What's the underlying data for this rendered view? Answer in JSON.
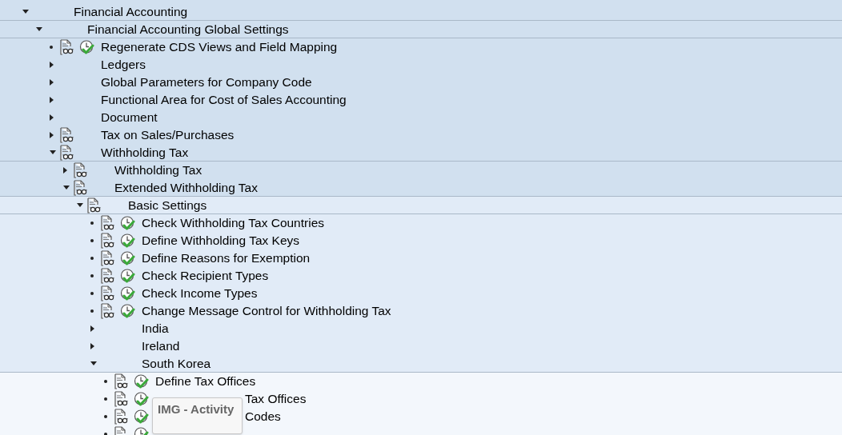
{
  "tree": [
    {
      "label": "Financial Accounting",
      "kind": "folder",
      "expanded": true,
      "has_docs": false,
      "children": [
        {
          "label": "Financial Accounting Global Settings",
          "kind": "folder",
          "expanded": true,
          "has_docs": false,
          "children": [
            {
              "label": "Regenerate CDS Views and Field Mapping",
              "kind": "activity"
            },
            {
              "label": "Ledgers",
              "kind": "folder",
              "expanded": false,
              "has_docs": false
            },
            {
              "label": "Global Parameters for Company Code",
              "kind": "folder",
              "expanded": false,
              "has_docs": false
            },
            {
              "label": "Functional Area for Cost of Sales Accounting",
              "kind": "folder",
              "expanded": false,
              "has_docs": false
            },
            {
              "label": "Document",
              "kind": "folder",
              "expanded": false,
              "has_docs": false
            },
            {
              "label": "Tax on Sales/Purchases",
              "kind": "folder",
              "expanded": false,
              "has_docs": true
            },
            {
              "label": "Withholding Tax",
              "kind": "folder",
              "expanded": true,
              "has_docs": true,
              "children": [
                {
                  "label": "Withholding Tax",
                  "kind": "folder",
                  "expanded": false,
                  "has_docs": true
                },
                {
                  "label": "Extended Withholding Tax",
                  "kind": "folder",
                  "expanded": true,
                  "has_docs": true,
                  "children": [
                    {
                      "label": "Basic Settings",
                      "kind": "folder",
                      "expanded": true,
                      "has_docs": true,
                      "children": [
                        {
                          "label": "Check Withholding Tax Countries",
                          "kind": "activity"
                        },
                        {
                          "label": "Define Withholding Tax Keys",
                          "kind": "activity"
                        },
                        {
                          "label": "Define Reasons for Exemption",
                          "kind": "activity"
                        },
                        {
                          "label": "Check Recipient Types",
                          "kind": "activity"
                        },
                        {
                          "label": "Check Income Types",
                          "kind": "activity"
                        },
                        {
                          "label": "Change Message Control for Withholding Tax",
                          "kind": "activity"
                        },
                        {
                          "label": "India",
                          "kind": "folder",
                          "expanded": false,
                          "has_docs": false
                        },
                        {
                          "label": "Ireland",
                          "kind": "folder",
                          "expanded": false,
                          "has_docs": false
                        },
                        {
                          "label": "South Korea",
                          "kind": "folder",
                          "expanded": true,
                          "has_docs": false,
                          "children": [
                            {
                              "label": "Define Tax Offices",
                              "kind": "activity"
                            },
                            {
                              "label": "Tax Offices",
                              "kind": "activity",
                              "covered": true
                            },
                            {
                              "label": "Codes",
                              "kind": "activity",
                              "covered": true
                            },
                            {
                              "kind": "activity"
                            }
                          ]
                        }
                      ]
                    }
                  ]
                }
              ]
            }
          ]
        }
      ]
    }
  ],
  "tooltip": {
    "text": "IMG - Activity"
  }
}
